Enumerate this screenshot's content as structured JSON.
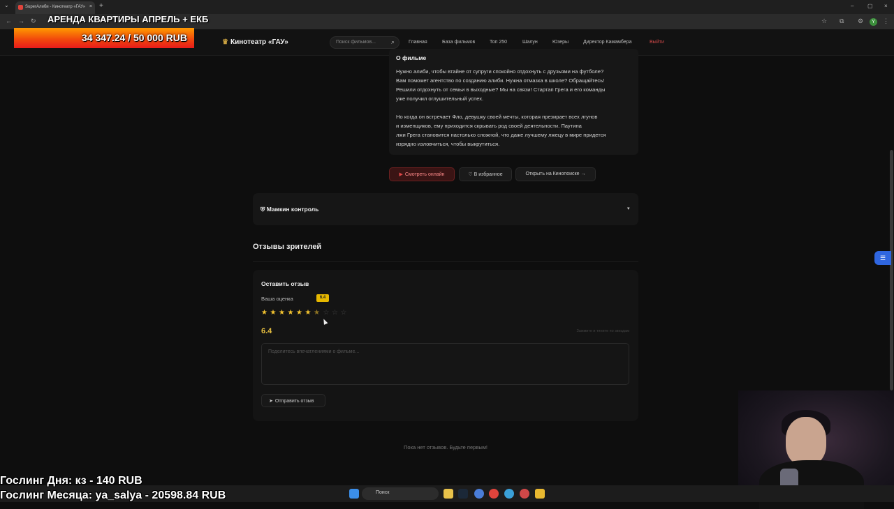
{
  "browser": {
    "tab_title": "SuperАлиби - Кинотеатр «ГАУ»",
    "tab_close": "×",
    "new_tab": "+",
    "menu": "⌄",
    "win_min": "–",
    "win_max": "▢",
    "win_close": "×",
    "profile_initial": "Y"
  },
  "overlay": {
    "title": "АРЕНДА КВАРТИРЫ АПРЕЛЬ + ЕКБ",
    "amount": "34 347.24 / 50 000 RUB",
    "progress": 0.687,
    "gosling_day": "Гослинг Дня: кз - 140 RUB",
    "gosling_month": "Гослинг Месяца: ya_salya - 20598.84 RUB"
  },
  "site": {
    "logo": "Кинотеатр «ГАУ»",
    "search_placeholder": "Поиск фильмов...",
    "nav": [
      "Главная",
      "База фильмов",
      "Топ 250",
      "Шалун",
      "Юзеры",
      "Директор Камамбера"
    ],
    "logout": "Выйти"
  },
  "film": {
    "about_title": "О фильме",
    "about_p1": "Нужно алиби, чтобы втайне от супруги спокойно отдохнуть с друзьями на футболе?\nВам поможет агентство по созданию алиби. Нужна отмазка в школе? Обращайтесь!\nРешили отдохнуть от семьи в выходные? Мы на связи! Стартап Грега и его команды\nуже получил оглушительный успех.",
    "about_p2": "Но когда он встречает Фло, девушку своей мечты, которая презирает всех лгунов\nи изменщиков, ему приходится скрывать род своей деятельности. Паутина\nлжи Грега становится настолько сложной, что даже лучшему лжецу в мире придется\nизрядно изловчиться, чтобы выкрутиться.",
    "watch": "Смотреть онлайн",
    "favorite": "В избранное",
    "kinopoisk": "Открыть на Кинопоиске →"
  },
  "parental": {
    "title": "Мамкин контроль",
    "chevron": "▾"
  },
  "reviews": {
    "heading": "Отзывы зрителей",
    "form_title": "Оставить отзыв",
    "rating_label": "Ваша оценка",
    "rating_badge": "6.4",
    "rating_value": "6.4",
    "stars_total": 10,
    "stars_filled": 6.4,
    "hint": "Зажмите и тяните по звездам",
    "placeholder": "Поделитесь впечатлениями о фильме...",
    "submit": "Отправить отзыв",
    "empty": "Пока нет отзывов. Будьте первым!"
  },
  "taskbar": {
    "search": "Поиск"
  }
}
